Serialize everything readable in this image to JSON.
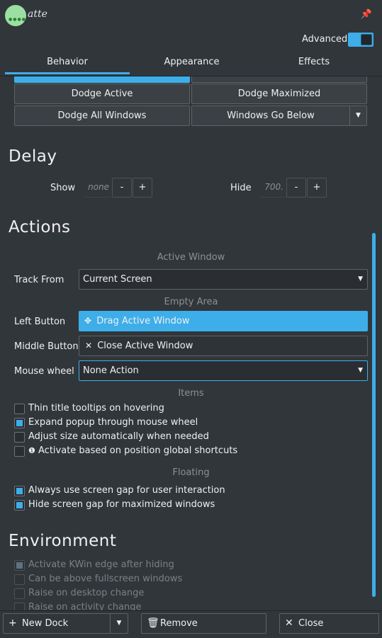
{
  "header": {
    "logo_text": "atte",
    "pin_icon": "pin-icon",
    "advanced_label": "Advanced",
    "advanced_on": true
  },
  "tabs": [
    {
      "label": "Behavior",
      "active": true
    },
    {
      "label": "Appearance",
      "active": false
    },
    {
      "label": "Effects",
      "active": false
    }
  ],
  "visibility": {
    "buttons": [
      "Dodge Active",
      "Dodge Maximized",
      "Dodge All Windows",
      "Windows Go Below"
    ]
  },
  "delay": {
    "title": "Delay",
    "show_label": "Show",
    "show_value": "none",
    "hide_label": "Hide",
    "hide_value": "700.",
    "minus": "-",
    "plus": "+"
  },
  "actions": {
    "title": "Actions",
    "active_window_header": "Active Window",
    "track_from_label": "Track From",
    "track_from_value": "Current Screen",
    "empty_area_header": "Empty Area",
    "left_button_label": "Left Button",
    "left_button_value": "Drag Active Window",
    "middle_button_label": "Middle Button",
    "middle_button_value": "Close Active Window",
    "mouse_wheel_label": "Mouse wheel",
    "mouse_wheel_value": "None Action",
    "items_header": "Items",
    "items": [
      {
        "label": "Thin title tooltips on hovering",
        "checked": false
      },
      {
        "label": "Expand popup through mouse wheel",
        "checked": true
      },
      {
        "label": "Adjust size automatically when needed",
        "checked": false
      },
      {
        "label": "Activate based on position global shortcuts",
        "checked": false
      }
    ],
    "floating_header": "Floating",
    "floating": [
      {
        "label": "Always use screen gap for user interaction",
        "checked": true
      },
      {
        "label": "Hide screen gap for maximized windows",
        "checked": true
      }
    ]
  },
  "environment": {
    "title": "Environment",
    "items": [
      {
        "label": "Activate KWin edge after hiding",
        "checked": true
      },
      {
        "label": "Can be above fullscreen windows",
        "checked": false
      },
      {
        "label": "Raise on desktop change",
        "checked": false
      },
      {
        "label": "Raise on activity change",
        "checked": false
      }
    ]
  },
  "footer": {
    "new_dock": "New Dock",
    "remove": "Remove",
    "close": "Close"
  },
  "colors": {
    "accent": "#3daee9",
    "background": "#31363b"
  }
}
